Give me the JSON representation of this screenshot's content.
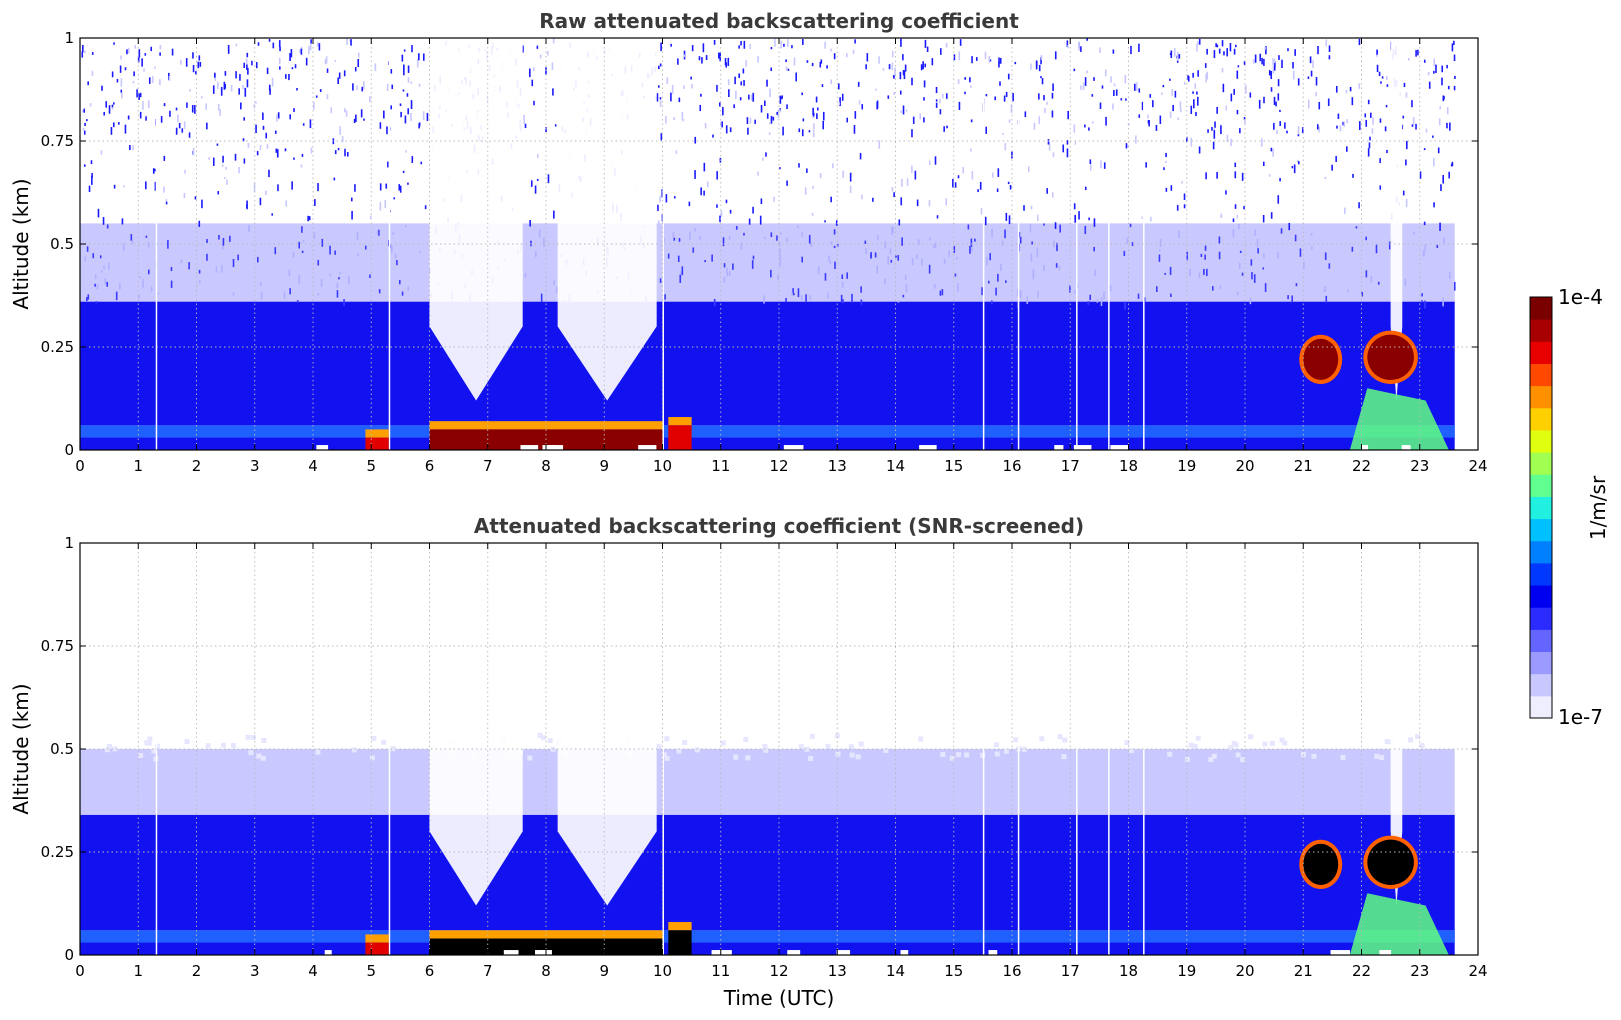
{
  "chart_data": [
    {
      "type": "heatmap",
      "title": "Raw attenuated backscattering coefficient",
      "xlabel": "",
      "ylabel": "Altitude (km)",
      "xlim": [
        0,
        24
      ],
      "ylim": [
        0,
        1
      ],
      "xticks": [
        "0",
        "1",
        "2",
        "3",
        "4",
        "5",
        "6",
        "7",
        "8",
        "9",
        "10",
        "11",
        "12",
        "13",
        "14",
        "15",
        "16",
        "17",
        "18",
        "19",
        "20",
        "21",
        "22",
        "23",
        "24"
      ],
      "yticks": [
        "0",
        "0.25",
        "0.5",
        "0.75",
        "1"
      ],
      "grid": true,
      "data_end_time": 23.6,
      "noisy_upper_layer": true,
      "clear_gaps": [
        [
          6.0,
          7.6
        ],
        [
          8.2,
          9.9
        ],
        [
          22.5,
          22.7
        ]
      ],
      "layers": [
        {
          "from_alt": 0.0,
          "to_alt": 0.06,
          "level": "blue",
          "note": "near-surface layer"
        },
        {
          "from_alt": 0.06,
          "to_alt": 0.36,
          "level": "blue"
        },
        {
          "from_alt": 0.36,
          "to_alt": 0.55,
          "level": "light blue"
        }
      ],
      "features": [
        {
          "time": [
            6.0,
            10.0
          ],
          "alt": [
            0.0,
            0.05
          ],
          "level": "dark red"
        },
        {
          "time": [
            4.9,
            5.3
          ],
          "alt": [
            0.0,
            0.03
          ],
          "level": "red"
        },
        {
          "time": [
            10.1,
            10.5
          ],
          "alt": [
            0.0,
            0.06
          ],
          "level": "red"
        },
        {
          "time": [
            21.0,
            21.6
          ],
          "alt": [
            0.17,
            0.27
          ],
          "level": "dark red"
        },
        {
          "time": [
            22.1,
            22.9
          ],
          "alt": [
            0.17,
            0.28
          ],
          "level": "dark red"
        },
        {
          "time": [
            21.8,
            23.5
          ],
          "alt": [
            0.0,
            0.15
          ],
          "level": "green"
        }
      ]
    },
    {
      "type": "heatmap",
      "title": "Attenuated backscattering coefficient (SNR-screened)",
      "xlabel": "Time (UTC)",
      "ylabel": "Altitude (km)",
      "xlim": [
        0,
        24
      ],
      "ylim": [
        0,
        1
      ],
      "xticks": [
        "0",
        "1",
        "2",
        "3",
        "4",
        "5",
        "6",
        "7",
        "8",
        "9",
        "10",
        "11",
        "12",
        "13",
        "14",
        "15",
        "16",
        "17",
        "18",
        "19",
        "20",
        "21",
        "22",
        "23",
        "24"
      ],
      "yticks": [
        "0",
        "0.25",
        "0.5",
        "0.75",
        "1"
      ],
      "grid": true,
      "data_end_time": 23.6,
      "noisy_upper_layer": false,
      "clear_gaps": [
        [
          6.0,
          7.6
        ],
        [
          8.2,
          9.9
        ],
        [
          22.5,
          22.7
        ]
      ],
      "layers": [
        {
          "from_alt": 0.0,
          "to_alt": 0.06,
          "level": "blue",
          "note": "near-surface layer"
        },
        {
          "from_alt": 0.06,
          "to_alt": 0.34,
          "level": "blue"
        },
        {
          "from_alt": 0.34,
          "to_alt": 0.5,
          "level": "light blue"
        }
      ],
      "features": [
        {
          "time": [
            6.0,
            10.0
          ],
          "alt": [
            0.0,
            0.04
          ],
          "level": "black"
        },
        {
          "time": [
            4.9,
            5.3
          ],
          "alt": [
            0.0,
            0.03
          ],
          "level": "red"
        },
        {
          "time": [
            10.1,
            10.5
          ],
          "alt": [
            0.0,
            0.06
          ],
          "level": "black"
        },
        {
          "time": [
            21.0,
            21.6
          ],
          "alt": [
            0.17,
            0.27
          ],
          "level": "black"
        },
        {
          "time": [
            22.1,
            22.9
          ],
          "alt": [
            0.17,
            0.28
          ],
          "level": "black"
        },
        {
          "time": [
            21.8,
            23.5
          ],
          "alt": [
            0.0,
            0.15
          ],
          "level": "green"
        }
      ]
    }
  ],
  "colorbar": {
    "min_label": "1e-7",
    "max_label": "1e-4",
    "unit_label": "1/m/sr",
    "colors": [
      "#eeeeff",
      "#c8c8ff",
      "#9b9bff",
      "#6464ff",
      "#2b2bff",
      "#0000f0",
      "#0038ff",
      "#0080ff",
      "#00c0ff",
      "#20f0e0",
      "#60ff90",
      "#a0ff50",
      "#e0ff10",
      "#ffd000",
      "#ff9000",
      "#ff4800",
      "#e80000",
      "#a80000",
      "#7a0000"
    ]
  },
  "colors": {
    "background": "#ffffff",
    "blue": "#1212f0",
    "light_blue": "#c9c9ff",
    "very_light": "#e6e6ff",
    "dark_red": "#8a0000",
    "black": "#000000",
    "grid": "#b9b9b9"
  }
}
